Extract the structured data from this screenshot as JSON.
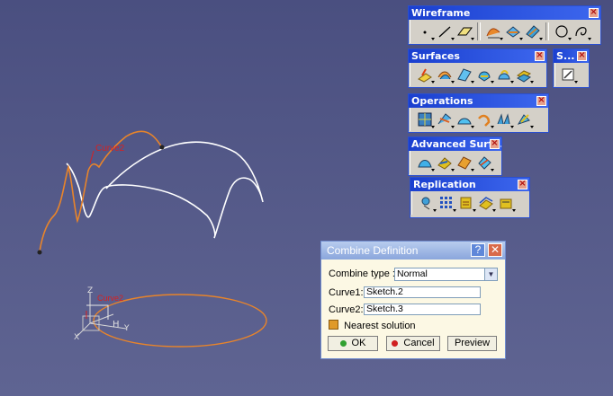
{
  "viewport": {
    "curve_label_top": "Curve2",
    "curve_label_bottom": "Curve2",
    "axis_x": "X",
    "axis_y": "Y",
    "axis_z": "Z",
    "axis_h": "H"
  },
  "toolbars": {
    "wireframe": {
      "title": "Wireframe"
    },
    "surfaces": {
      "title": "Surfaces"
    },
    "sketch": {
      "title": "S..."
    },
    "operations": {
      "title": "Operations"
    },
    "advanced": {
      "title": "Advanced Surf..."
    },
    "replication": {
      "title": "Replication"
    }
  },
  "dialog": {
    "title": "Combine Definition",
    "help_label": "?",
    "close_label": "✕",
    "combine_type_label": "Combine type :",
    "combine_type_value": "Normal",
    "curve1_label": "Curve1:",
    "curve1_value": "Sketch.2",
    "curve2_label": "Curve2:",
    "curve2_value": "Sketch.3",
    "nearest_label": "Nearest solution",
    "ok_label": "OK",
    "cancel_label": "Cancel",
    "preview_label": "Preview"
  },
  "colors": {
    "orange_curve": "#e8842a",
    "white_curve": "#ffffff",
    "label_red": "#d82020",
    "title_blue": "#1a3fcf"
  }
}
